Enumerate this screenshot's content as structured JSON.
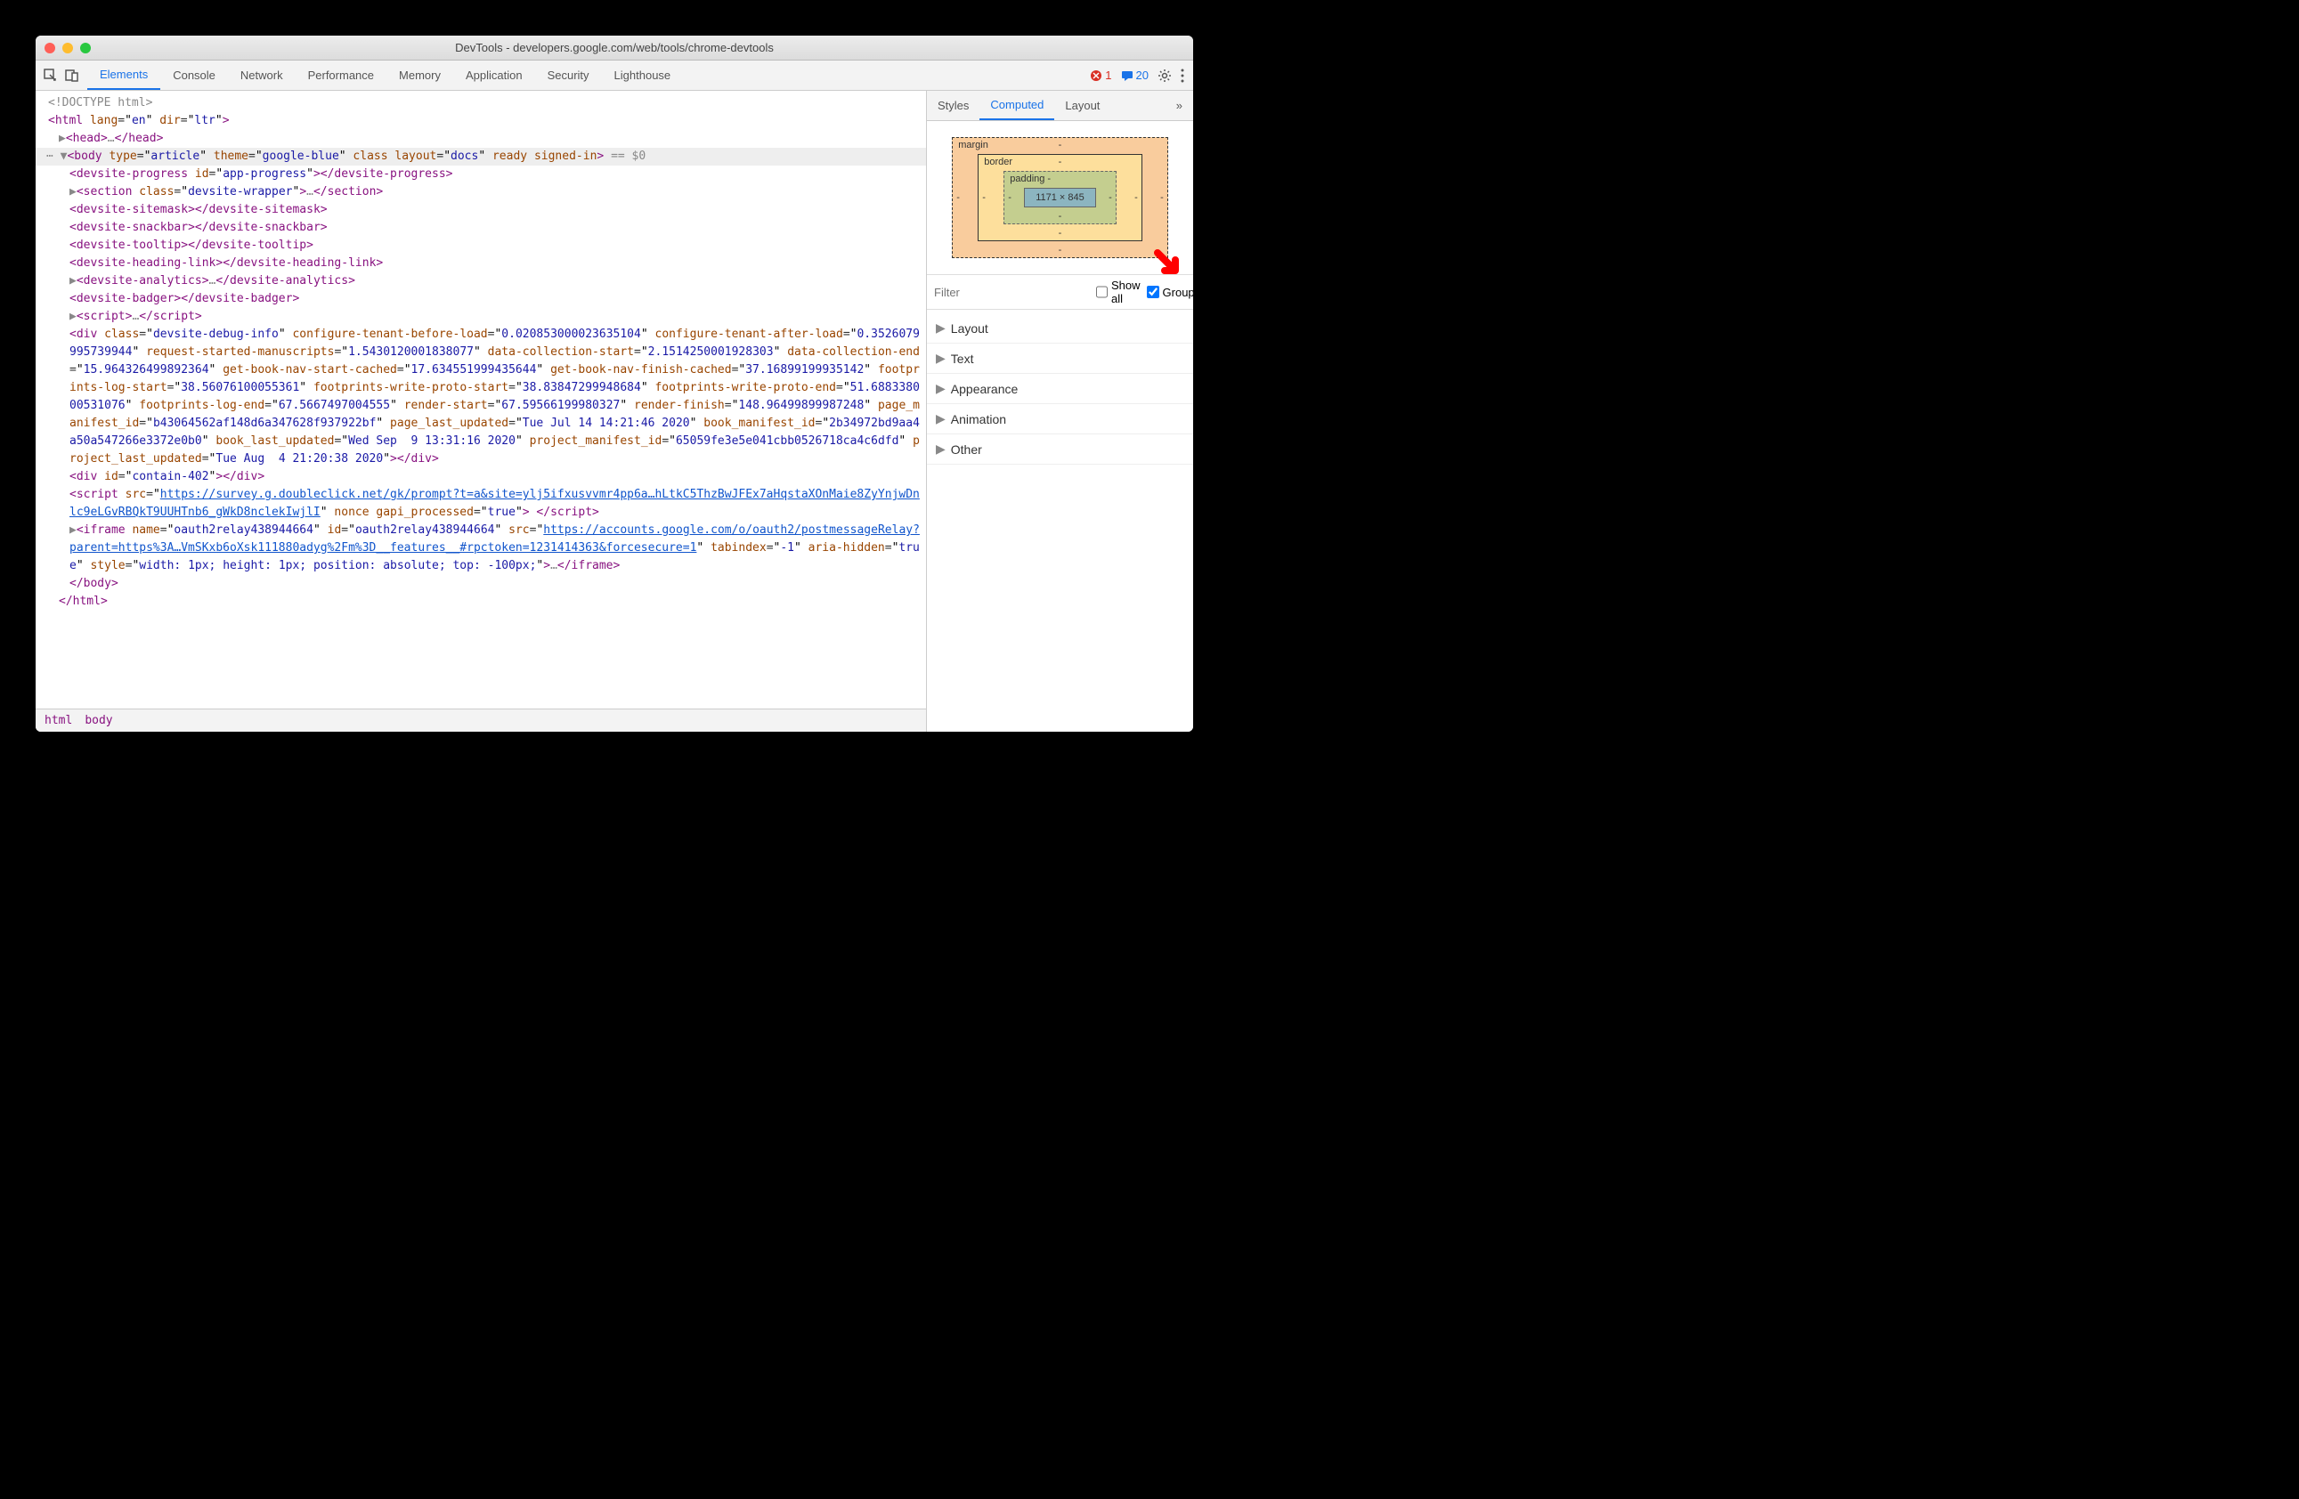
{
  "window": {
    "title": "DevTools - developers.google.com/web/tools/chrome-devtools"
  },
  "toolbar": {
    "tabs": [
      "Elements",
      "Console",
      "Network",
      "Performance",
      "Memory",
      "Application",
      "Security",
      "Lighthouse"
    ],
    "active_tab": "Elements",
    "errors": "1",
    "warnings": "20"
  },
  "dom": {
    "doctype": "<!DOCTYPE html>",
    "html_open": {
      "tag": "html",
      "attrs": [
        [
          "lang",
          "en"
        ],
        [
          "dir",
          "ltr"
        ]
      ]
    },
    "head": {
      "tag": "head",
      "ellipsis": "…"
    },
    "body_open": {
      "tag": "body",
      "attrs": [
        [
          "type",
          "article"
        ],
        [
          "theme",
          "google-blue"
        ]
      ],
      "flags": "class layout=\"docs\" ready signed-in",
      "suffix": "== $0"
    },
    "children": [
      {
        "open": {
          "tag": "devsite-progress",
          "attrs": [
            [
              "id",
              "app-progress"
            ]
          ]
        },
        "close": "devsite-progress"
      },
      {
        "arrow": true,
        "open": {
          "tag": "section",
          "attrs": [
            [
              "class",
              "devsite-wrapper"
            ]
          ]
        },
        "ellipsis": "…",
        "close": "section"
      },
      {
        "open": {
          "tag": "devsite-sitemask"
        },
        "close": "devsite-sitemask"
      },
      {
        "open": {
          "tag": "devsite-snackbar"
        },
        "close": "devsite-snackbar"
      },
      {
        "open": {
          "tag": "devsite-tooltip"
        },
        "close": "devsite-tooltip"
      },
      {
        "open": {
          "tag": "devsite-heading-link"
        },
        "close": "devsite-heading-link"
      },
      {
        "arrow": true,
        "open": {
          "tag": "devsite-analytics"
        },
        "ellipsis": "…",
        "close": "devsite-analytics"
      },
      {
        "open": {
          "tag": "devsite-badger"
        },
        "close": "devsite-badger"
      },
      {
        "arrow": true,
        "open": {
          "tag": "script"
        },
        "ellipsis": "…",
        "close": "script"
      }
    ],
    "div_debug": {
      "tag": "div",
      "attrs": [
        [
          "class",
          "devsite-debug-info"
        ],
        [
          "configure-tenant-before-load",
          "0.020853000023635104"
        ],
        [
          "configure-tenant-after-load",
          "0.3526079995739944"
        ],
        [
          "request-started-manuscripts",
          "1.5430120001838077"
        ],
        [
          "data-collection-start",
          "2.1514250001928303"
        ],
        [
          "data-collection-end",
          "15.964326499892364"
        ],
        [
          "get-book-nav-start-cached",
          "17.634551999435644"
        ],
        [
          "get-book-nav-finish-cached",
          "37.16899199935142"
        ],
        [
          "footprints-log-start",
          "38.56076100055361"
        ],
        [
          "footprints-write-proto-start",
          "38.83847299948684"
        ],
        [
          "footprints-write-proto-end",
          "51.688338000531076"
        ],
        [
          "footprints-log-end",
          "67.5667497004555"
        ],
        [
          "render-start",
          "67.59566199980327"
        ],
        [
          "render-finish",
          "148.96499899987248"
        ],
        [
          "page_manifest_id",
          "b43064562af148d6a347628f937922bf"
        ],
        [
          "page_last_updated",
          "Tue Jul 14 14:21:46 2020"
        ],
        [
          "book_manifest_id",
          "2b34972bd9aa4a50a547266e3372e0b0"
        ],
        [
          "book_last_updated",
          "Wed Sep  9 13:31:16 2020"
        ],
        [
          "project_manifest_id",
          "65059fe3e5e041cbb0526718ca4c6dfd"
        ],
        [
          "project_last_updated",
          "Tue Aug  4 21:20:38 2020"
        ]
      ],
      "close": "div"
    },
    "div_contain": {
      "tag": "div",
      "attrs": [
        [
          "id",
          "contain-402"
        ]
      ],
      "close": "div"
    },
    "script_survey": {
      "tag": "script",
      "src": "https://survey.g.doubleclick.net/gk/prompt?t=a&site=ylj5ifxusvvmr4pp6a…hLtkC5ThzBwJFEx7aHqstaXOnMaie8ZyYnjwDnlc9eLGvRBQkT9UUHTnb6_gWkD8nclekIwjlI",
      "tail_attrs": [
        [
          "nonce",
          ""
        ],
        [
          "gapi_processed",
          "true"
        ]
      ],
      "close": "script"
    },
    "iframe": {
      "tag": "iframe",
      "attrs": [
        [
          "name",
          "oauth2relay438944664"
        ],
        [
          "id",
          "oauth2relay438944664"
        ]
      ],
      "src": "https://accounts.google.com/o/oauth2/postmessageRelay?parent=https%3A…VmSKxb6oXsk111880adyg%2Fm%3D__features__#rpctoken=1231414363&forcesecure=1",
      "tail_attrs": [
        [
          "tabindex",
          "-1"
        ],
        [
          "aria-hidden",
          "true"
        ],
        [
          "style",
          "width: 1px; height: 1px; position: absolute; top: -100px;"
        ]
      ],
      "ellipsis": "…",
      "close": "iframe"
    },
    "body_close": "body",
    "html_close": "html"
  },
  "breadcrumb": [
    "html",
    "body"
  ],
  "side": {
    "tabs": [
      "Styles",
      "Computed",
      "Layout"
    ],
    "active": "Computed",
    "box": {
      "margin": "margin",
      "border": "border",
      "padding": "padding",
      "content": "1171 × 845"
    },
    "filter_placeholder": "Filter",
    "showall_label": "Show all",
    "group_label": "Group",
    "showall_checked": false,
    "group_checked": true,
    "groups": [
      "Layout",
      "Text",
      "Appearance",
      "Animation",
      "Other"
    ]
  }
}
